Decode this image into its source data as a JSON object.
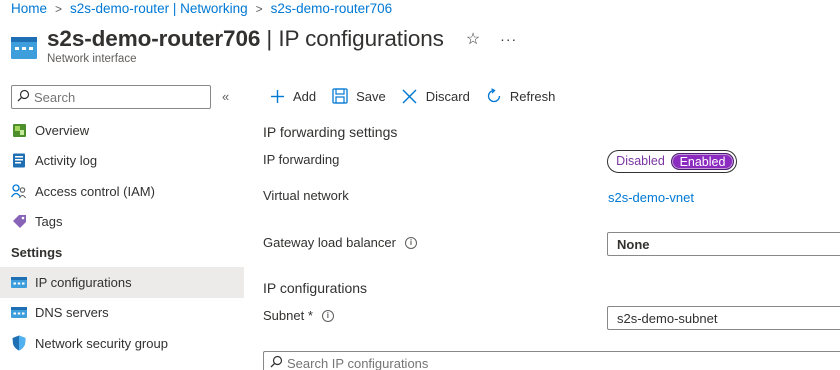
{
  "breadcrumb": {
    "items": [
      "Home",
      "s2s-demo-router | Networking",
      "s2s-demo-router706"
    ],
    "separator": ">"
  },
  "header": {
    "resource_name": "s2s-demo-router706",
    "title_suffix": " | IP configurations",
    "subtitle": "Network interface",
    "favorite_icon": "star-icon",
    "more_label": "···"
  },
  "sidebar": {
    "search_placeholder": "Search",
    "collapse_label": "«",
    "items": [
      {
        "label": "Overview",
        "icon": "overview-icon"
      },
      {
        "label": "Activity log",
        "icon": "activity-log-icon"
      },
      {
        "label": "Access control (IAM)",
        "icon": "iam-icon"
      },
      {
        "label": "Tags",
        "icon": "tag-icon"
      }
    ],
    "section": "Settings",
    "settings_items": [
      {
        "label": "IP configurations",
        "icon": "ip-config-icon",
        "active": true
      },
      {
        "label": "DNS servers",
        "icon": "dns-icon"
      },
      {
        "label": "Network security group",
        "icon": "shield-icon"
      }
    ]
  },
  "toolbar": {
    "add": "Add",
    "save": "Save",
    "discard": "Discard",
    "refresh": "Refresh"
  },
  "content": {
    "forwarding_heading": "IP forwarding settings",
    "ip_forwarding_label": "IP forwarding",
    "toggle": {
      "off": "Disabled",
      "on": "Enabled",
      "value": "Enabled"
    },
    "vnet_label": "Virtual network",
    "vnet_value": "s2s-demo-vnet",
    "gwlb_label": "Gateway load balancer",
    "gwlb_value": "None",
    "ipconfig_heading": "IP configurations",
    "subnet_label": "Subnet *",
    "subnet_value": "s2s-demo-subnet",
    "grid_search_placeholder": "Search IP configurations"
  },
  "colors": {
    "accent": "#0078d4",
    "toggle_on": "#8b2bc0",
    "active_nav": "#edebe9"
  }
}
